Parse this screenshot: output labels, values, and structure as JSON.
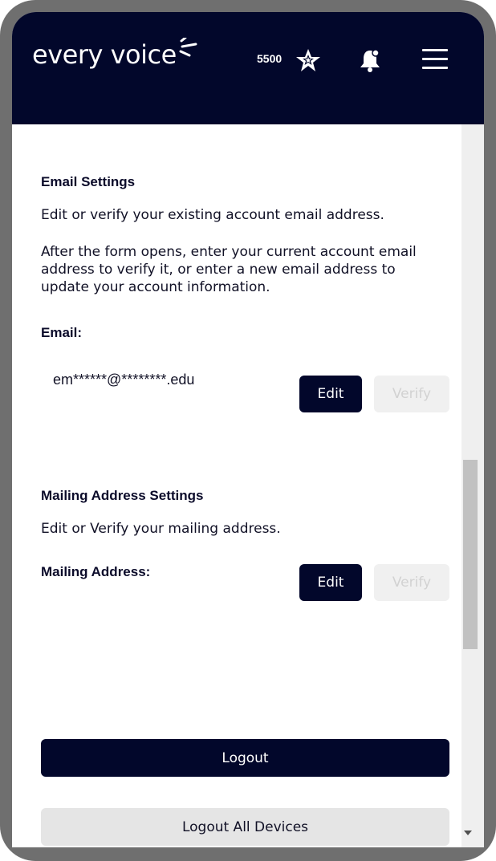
{
  "header": {
    "logo_text": "every voice",
    "points": "5500",
    "icons": [
      "star-badge-icon",
      "bell-icon",
      "hamburger-menu-icon"
    ],
    "background_color": "#02072b"
  },
  "email_settings": {
    "title": "Email Settings",
    "description": "Edit or  verify your existing account email address.",
    "instructions": "After the form opens, enter your current account email address to verify it, or enter a new email address to update your account information.",
    "field_label": "Email:",
    "masked_email": "em******@********.edu",
    "edit_label": "Edit",
    "verify_label": "Verify"
  },
  "mailing_settings": {
    "title": "Mailing Address Settings",
    "description": "Edit or Verify your mailing address.",
    "field_label": "Mailing Address:",
    "edit_label": "Edit",
    "verify_label": "Verify"
  },
  "actions": {
    "logout_label": "Logout",
    "logout_all_label": "Logout All Devices"
  },
  "colors": {
    "primary": "#02072b",
    "disabled_bg": "#f0f0f0",
    "secondary_bg": "#e5e5e5"
  }
}
